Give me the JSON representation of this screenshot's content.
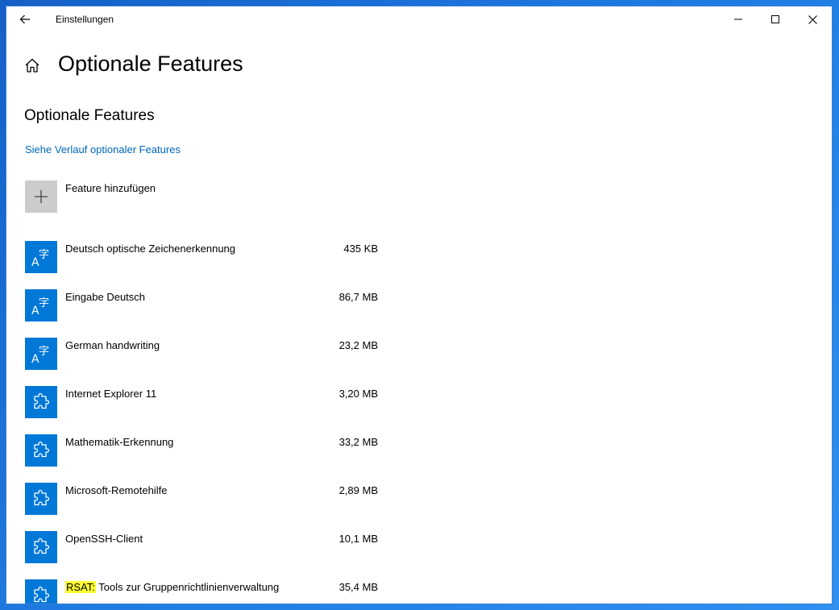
{
  "window": {
    "title": "Einstellungen"
  },
  "header": {
    "page_title": "Optionale Features"
  },
  "section": {
    "title": "Optionale Features",
    "history_link": "Siehe Verlauf optionaler Features"
  },
  "add_feature": {
    "label": "Feature hinzufügen",
    "icon": "plus-icon"
  },
  "features": [
    {
      "prefix": "",
      "name": "Deutsch optische Zeichenerkennung",
      "size": "435 KB",
      "icon": "language-icon"
    },
    {
      "prefix": "",
      "name": "Eingabe Deutsch",
      "size": "86,7 MB",
      "icon": "language-icon"
    },
    {
      "prefix": "",
      "name": "German handwriting",
      "size": "23,2 MB",
      "icon": "language-icon"
    },
    {
      "prefix": "",
      "name": "Internet Explorer 11",
      "size": "3,20 MB",
      "icon": "puzzle-icon"
    },
    {
      "prefix": "",
      "name": "Mathematik-Erkennung",
      "size": "33,2 MB",
      "icon": "puzzle-icon"
    },
    {
      "prefix": "",
      "name": "Microsoft-Remotehilfe",
      "size": "2,89 MB",
      "icon": "puzzle-icon"
    },
    {
      "prefix": "",
      "name": "OpenSSH-Client",
      "size": "10,1 MB",
      "icon": "puzzle-icon"
    },
    {
      "prefix": "RSAT:",
      "name": " Tools zur Gruppenrichtlinienverwaltung",
      "size": "35,4 MB",
      "icon": "puzzle-icon"
    }
  ],
  "colors": {
    "accent": "#0078d7",
    "link": "#0067b8",
    "highlight": "#ffff33",
    "add_tile": "#cccccc"
  }
}
